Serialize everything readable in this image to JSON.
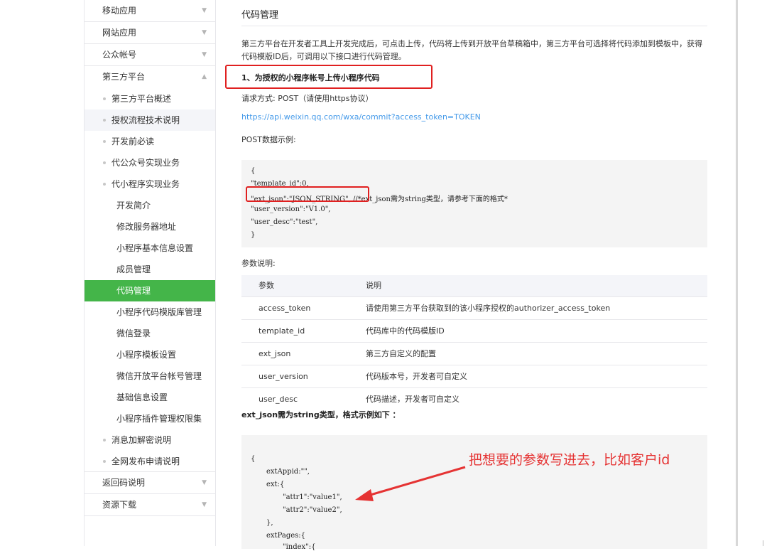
{
  "sidebar": {
    "top_items": [
      {
        "label": "移动应用"
      },
      {
        "label": "网站应用"
      },
      {
        "label": "公众帐号"
      },
      {
        "label": "第三方平台"
      }
    ],
    "sub_items": [
      {
        "label": "第三方平台概述"
      },
      {
        "label": "授权流程技术说明"
      },
      {
        "label": "开发前必读"
      },
      {
        "label": "代公众号实现业务"
      },
      {
        "label": "代小程序实现业务"
      }
    ],
    "sub2_items": [
      {
        "label": "开发简介"
      },
      {
        "label": "修改服务器地址"
      },
      {
        "label": "小程序基本信息设置"
      },
      {
        "label": "成员管理"
      },
      {
        "label": "代码管理"
      },
      {
        "label": "小程序代码模版库管理"
      },
      {
        "label": "微信登录"
      },
      {
        "label": "小程序模板设置"
      },
      {
        "label": "微信开放平台帐号管理"
      },
      {
        "label": "基础信息设置"
      },
      {
        "label": "小程序插件管理权限集"
      }
    ],
    "sub_items_after": [
      {
        "label": "消息加解密说明"
      },
      {
        "label": "全网发布申请说明"
      }
    ],
    "bottom_items": [
      {
        "label": "返回码说明"
      },
      {
        "label": "资源下载"
      }
    ]
  },
  "main": {
    "page_title": "代码管理",
    "intro": "第三方平台在开发者工具上开发完成后，可点击上传，代码将上传到开放平台草稿箱中，第三方平台可选择将代码添加到模板中，获得代码模版ID后，可调用以下接口进行代码管理。",
    "section_title": "1、为授权的小程序帐号上传小程序代码",
    "request_method": "请求方式: POST（请使用https协议）",
    "url": "https://api.weixin.qq.com/wxa/commit?access_token=TOKEN",
    "post_label": "POST数据示例:",
    "code_lines": [
      "{",
      "\"template_id\":0,",
      "\"ext_json\":\"JSON_STRING\", //*ext_json需为string类型，请参考下面的格式*",
      "\"user_version\":\"V1.0\",",
      "\"user_desc\":\"test\",",
      "}"
    ],
    "param_label": "参数说明:",
    "table": {
      "headers": [
        "参数",
        "说明"
      ],
      "rows": [
        [
          "access_token",
          "请使用第三方平台获取到的该小程序授权的authorizer_access_token"
        ],
        [
          "template_id",
          "代码库中的代码模版ID"
        ],
        [
          "ext_json",
          "第三方自定义的配置"
        ],
        [
          "user_version",
          "代码版本号，开发者可自定义"
        ],
        [
          "user_desc",
          "代码描述，开发者可自定义"
        ]
      ]
    },
    "ext_title": "ext_json需为string类型，格式示例如下 ：",
    "code2_lines": [
      "{",
      "extAppid:\"\",",
      "ext:{",
      "\"attr1\":\"value1\",",
      "\"attr2\":\"value2\",",
      "},",
      "extPages:{",
      "\"index\":{"
    ],
    "annotation": "把想要的参数写进去，比如客户id"
  },
  "colors": {
    "active_green": "#44b549",
    "link_blue": "#459ae9",
    "annotation_red": "#e53333"
  }
}
